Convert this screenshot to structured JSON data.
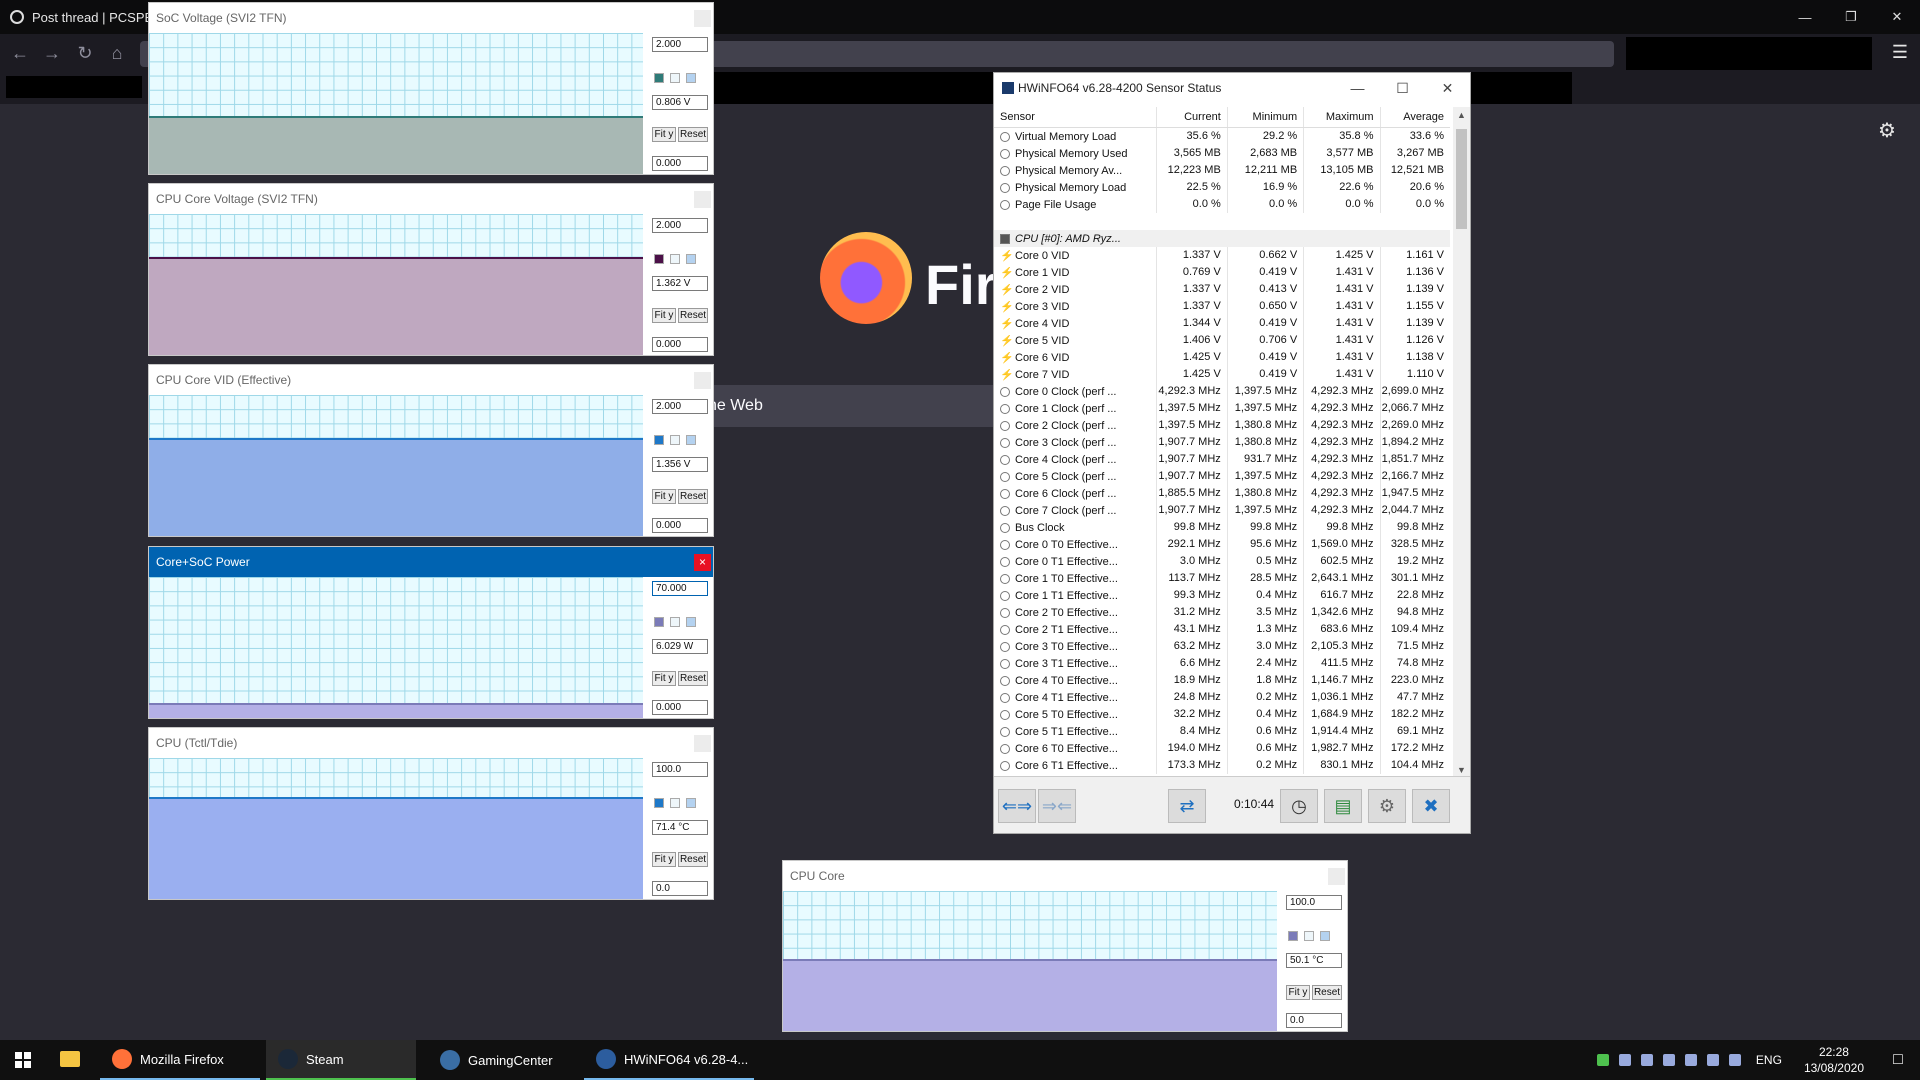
{
  "firefox": {
    "tab_title": "Post thread | PCSPECI",
    "brand_word": "Fire",
    "search_fragment": "he Web"
  },
  "graphs": [
    {
      "title": "SoC Voltage (SVI2 TFN)",
      "max": "2.000",
      "current": "0.806 V",
      "min": "0.000",
      "fit": "Fit y",
      "reset": "Reset",
      "color": "#2f7b78",
      "fill_color": "#a8b8b4",
      "fill_pct": 40,
      "active": false
    },
    {
      "title": "CPU Core Voltage (SVI2 TFN)",
      "max": "2.000",
      "current": "1.362 V",
      "min": "0.000",
      "fit": "Fit y",
      "reset": "Reset",
      "color": "#4b1048",
      "fill_color": "#bfa8c0",
      "fill_pct": 68,
      "active": false
    },
    {
      "title": "CPU Core VID (Effective)",
      "max": "2.000",
      "current": "1.356 V",
      "min": "0.000",
      "fit": "Fit y",
      "reset": "Reset",
      "color": "#1e78c8",
      "fill_color": "#8faee8",
      "fill_pct": 68,
      "active": false
    },
    {
      "title": "Core+SoC Power",
      "max": "70.000",
      "current": "6.029 W",
      "min": "0.000",
      "fit": "Fit y",
      "reset": "Reset",
      "color": "#7b7bb8",
      "fill_color": "#b4b0e6",
      "fill_pct": 9,
      "active": true
    },
    {
      "title": "CPU (Tctl/Tdie)",
      "max": "100.0",
      "current": "71.4 °C",
      "min": "0.0",
      "fit": "Fit y",
      "reset": "Reset",
      "color": "#1e78c8",
      "fill_color": "#9aaff0",
      "fill_pct": 71,
      "active": false
    },
    {
      "title": "CPU Core",
      "max": "100.0",
      "current": "50.1 °C",
      "min": "0.0",
      "fit": "Fit y",
      "reset": "Reset",
      "color": "#7b7bb8",
      "fill_color": "#b4b0e6",
      "fill_pct": 50,
      "active": false
    }
  ],
  "hwinfo": {
    "title": "HWiNFO64 v6.28-4200 Sensor Status",
    "columns": [
      "Sensor",
      "Current",
      "Minimum",
      "Maximum",
      "Average"
    ],
    "rows_top": [
      {
        "name": "Virtual Memory Load",
        "cur": "35.6 %",
        "min": "29.2 %",
        "max": "35.8 %",
        "avg": "33.6 %"
      },
      {
        "name": "Physical Memory Used",
        "cur": "3,565 MB",
        "min": "2,683 MB",
        "max": "3,577 MB",
        "avg": "3,267 MB"
      },
      {
        "name": "Physical Memory Av...",
        "cur": "12,223 MB",
        "min": "12,211 MB",
        "max": "13,105 MB",
        "avg": "12,521 MB"
      },
      {
        "name": "Physical Memory Load",
        "cur": "22.5 %",
        "min": "16.9 %",
        "max": "22.6 %",
        "avg": "20.6 %"
      },
      {
        "name": "Page File Usage",
        "cur": "0.0 %",
        "min": "0.0 %",
        "max": "0.0 %",
        "avg": "0.0 %"
      }
    ],
    "group_label": "CPU [#0]: AMD Ryz...",
    "rows_vid": [
      {
        "name": "Core 0 VID",
        "cur": "1.337 V",
        "min": "0.662 V",
        "max": "1.425 V",
        "avg": "1.161 V"
      },
      {
        "name": "Core 1 VID",
        "cur": "0.769 V",
        "min": "0.419 V",
        "max": "1.431 V",
        "avg": "1.136 V"
      },
      {
        "name": "Core 2 VID",
        "cur": "1.337 V",
        "min": "0.413 V",
        "max": "1.431 V",
        "avg": "1.139 V"
      },
      {
        "name": "Core 3 VID",
        "cur": "1.337 V",
        "min": "0.650 V",
        "max": "1.431 V",
        "avg": "1.155 V"
      },
      {
        "name": "Core 4 VID",
        "cur": "1.344 V",
        "min": "0.419 V",
        "max": "1.431 V",
        "avg": "1.139 V"
      },
      {
        "name": "Core 5 VID",
        "cur": "1.406 V",
        "min": "0.706 V",
        "max": "1.431 V",
        "avg": "1.126 V"
      },
      {
        "name": "Core 6 VID",
        "cur": "1.425 V",
        "min": "0.419 V",
        "max": "1.431 V",
        "avg": "1.138 V"
      },
      {
        "name": "Core 7 VID",
        "cur": "1.425 V",
        "min": "0.419 V",
        "max": "1.431 V",
        "avg": "1.110 V"
      }
    ],
    "rows_clock": [
      {
        "name": "Core 0 Clock (perf ...",
        "cur": "4,292.3 MHz",
        "min": "1,397.5 MHz",
        "max": "4,292.3 MHz",
        "avg": "2,699.0 MHz"
      },
      {
        "name": "Core 1 Clock (perf ...",
        "cur": "1,397.5 MHz",
        "min": "1,397.5 MHz",
        "max": "4,292.3 MHz",
        "avg": "2,066.7 MHz"
      },
      {
        "name": "Core 2 Clock (perf ...",
        "cur": "1,397.5 MHz",
        "min": "1,380.8 MHz",
        "max": "4,292.3 MHz",
        "avg": "2,269.0 MHz"
      },
      {
        "name": "Core 3 Clock (perf ...",
        "cur": "1,907.7 MHz",
        "min": "1,380.8 MHz",
        "max": "4,292.3 MHz",
        "avg": "1,894.2 MHz"
      },
      {
        "name": "Core 4 Clock (perf ...",
        "cur": "1,907.7 MHz",
        "min": "931.7 MHz",
        "max": "4,292.3 MHz",
        "avg": "1,851.7 MHz"
      },
      {
        "name": "Core 5 Clock (perf ...",
        "cur": "1,907.7 MHz",
        "min": "1,397.5 MHz",
        "max": "4,292.3 MHz",
        "avg": "2,166.7 MHz"
      },
      {
        "name": "Core 6 Clock (perf ...",
        "cur": "1,885.5 MHz",
        "min": "1,380.8 MHz",
        "max": "4,292.3 MHz",
        "avg": "1,947.5 MHz"
      },
      {
        "name": "Core 7 Clock (perf ...",
        "cur": "1,907.7 MHz",
        "min": "1,397.5 MHz",
        "max": "4,292.3 MHz",
        "avg": "2,044.7 MHz"
      },
      {
        "name": "Bus Clock",
        "cur": "99.8 MHz",
        "min": "99.8 MHz",
        "max": "99.8 MHz",
        "avg": "99.8 MHz"
      },
      {
        "name": "Core 0 T0 Effective...",
        "cur": "292.1 MHz",
        "min": "95.6 MHz",
        "max": "1,569.0 MHz",
        "avg": "328.5 MHz"
      },
      {
        "name": "Core 0 T1 Effective...",
        "cur": "3.0 MHz",
        "min": "0.5 MHz",
        "max": "602.5 MHz",
        "avg": "19.2 MHz"
      },
      {
        "name": "Core 1 T0 Effective...",
        "cur": "113.7 MHz",
        "min": "28.5 MHz",
        "max": "2,643.1 MHz",
        "avg": "301.1 MHz"
      },
      {
        "name": "Core 1 T1 Effective...",
        "cur": "99.3 MHz",
        "min": "0.4 MHz",
        "max": "616.7 MHz",
        "avg": "22.8 MHz"
      },
      {
        "name": "Core 2 T0 Effective...",
        "cur": "31.2 MHz",
        "min": "3.5 MHz",
        "max": "1,342.6 MHz",
        "avg": "94.8 MHz"
      },
      {
        "name": "Core 2 T1 Effective...",
        "cur": "43.1 MHz",
        "min": "1.3 MHz",
        "max": "683.6 MHz",
        "avg": "109.4 MHz"
      },
      {
        "name": "Core 3 T0 Effective...",
        "cur": "63.2 MHz",
        "min": "3.0 MHz",
        "max": "2,105.3 MHz",
        "avg": "71.5 MHz"
      },
      {
        "name": "Core 3 T1 Effective...",
        "cur": "6.6 MHz",
        "min": "2.4 MHz",
        "max": "411.5 MHz",
        "avg": "74.8 MHz"
      },
      {
        "name": "Core 4 T0 Effective...",
        "cur": "18.9 MHz",
        "min": "1.8 MHz",
        "max": "1,146.7 MHz",
        "avg": "223.0 MHz"
      },
      {
        "name": "Core 4 T1 Effective...",
        "cur": "24.8 MHz",
        "min": "0.2 MHz",
        "max": "1,036.1 MHz",
        "avg": "47.7 MHz"
      },
      {
        "name": "Core 5 T0 Effective...",
        "cur": "32.2 MHz",
        "min": "0.4 MHz",
        "max": "1,684.9 MHz",
        "avg": "182.2 MHz"
      },
      {
        "name": "Core 5 T1 Effective...",
        "cur": "8.4 MHz",
        "min": "0.6 MHz",
        "max": "1,914.4 MHz",
        "avg": "69.1 MHz"
      },
      {
        "name": "Core 6 T0 Effective...",
        "cur": "194.0 MHz",
        "min": "0.6 MHz",
        "max": "1,982.7 MHz",
        "avg": "172.2 MHz"
      },
      {
        "name": "Core 6 T1 Effective...",
        "cur": "173.3 MHz",
        "min": "0.2 MHz",
        "max": "830.1 MHz",
        "avg": "104.4 MHz"
      }
    ],
    "timer": "0:10:44"
  },
  "taskbar": {
    "apps": [
      {
        "label": "Mozilla Firefox",
        "state": "open",
        "icon_color": "#ff7139"
      },
      {
        "label": "Steam",
        "state": "active",
        "icon_color": "#1b2838"
      },
      {
        "label": "GamingCenter",
        "state": "none",
        "icon_color": "#3a6ea5"
      },
      {
        "label": "HWiNFO64 v6.28-4...",
        "state": "open",
        "icon_color": "#2c5d9e"
      }
    ],
    "lang": "ENG",
    "time": "22:28",
    "date": "13/08/2020"
  }
}
